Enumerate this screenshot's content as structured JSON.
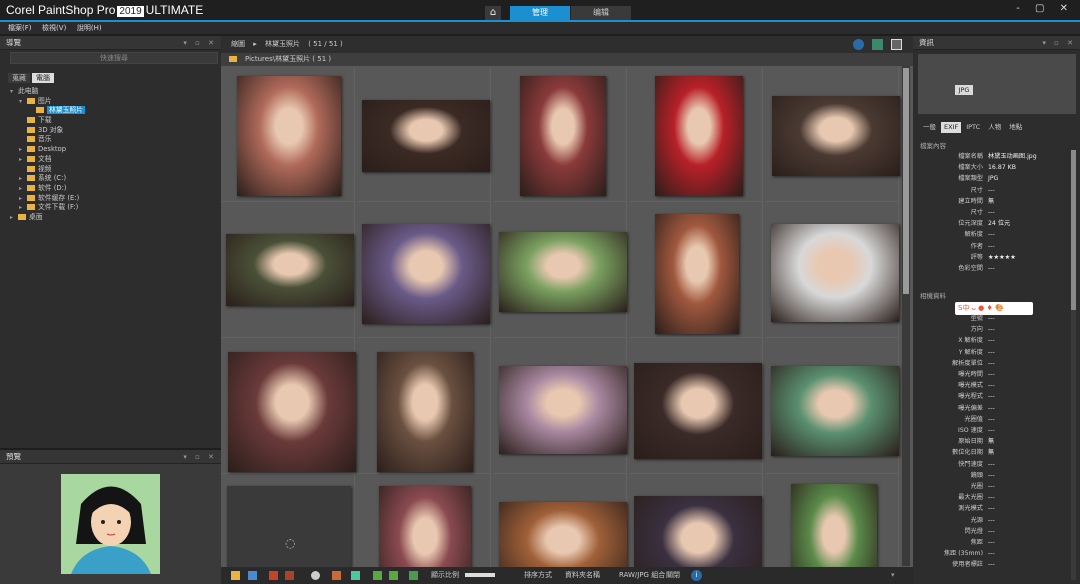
{
  "app": {
    "brand": "Corel PaintShop Pro",
    "year": "2019",
    "edition": "ULTIMATE",
    "tabs": [
      "管理",
      "编辑"
    ],
    "window_controls": "- ▢ ✕"
  },
  "menu": [
    "檔案(F)",
    "檢視(V)",
    "說明(H)"
  ],
  "nav": {
    "title": "導覽",
    "search_placeholder": "快速搜尋",
    "tabs": [
      "蒐藏",
      "電腦"
    ],
    "tree": [
      {
        "label": "此电脑",
        "depth": 0,
        "arrow": "▾",
        "folder": false
      },
      {
        "label": "图片",
        "depth": 1,
        "arrow": "▾",
        "folder": true
      },
      {
        "label": "林黛玉照片",
        "depth": 2,
        "arrow": "",
        "folder": true,
        "selected": true
      },
      {
        "label": "下载",
        "depth": 1,
        "arrow": "",
        "folder": true
      },
      {
        "label": "3D 对象",
        "depth": 1,
        "arrow": "",
        "folder": true
      },
      {
        "label": "音乐",
        "depth": 1,
        "arrow": "",
        "folder": true
      },
      {
        "label": "Desktop",
        "depth": 1,
        "arrow": "▸",
        "folder": true
      },
      {
        "label": "文档",
        "depth": 1,
        "arrow": "▸",
        "folder": true
      },
      {
        "label": "视频",
        "depth": 1,
        "arrow": "",
        "folder": true
      },
      {
        "label": "系统 (C:)",
        "depth": 1,
        "arrow": "▸",
        "folder": true
      },
      {
        "label": "软件 (D:)",
        "depth": 1,
        "arrow": "▸",
        "folder": true
      },
      {
        "label": "软件缓存 (E:)",
        "depth": 1,
        "arrow": "▸",
        "folder": true
      },
      {
        "label": "文件下载 (F:)",
        "depth": 1,
        "arrow": "▸",
        "folder": true
      },
      {
        "label": "桌面",
        "depth": 0,
        "arrow": "▸",
        "folder": true
      }
    ]
  },
  "preview": {
    "title": "預覽"
  },
  "main": {
    "crumb": "縮圖",
    "crumb_sep": "▸",
    "folder": "林黛玉照片",
    "count": "( 51 / 51 )",
    "path": "Pictures\\林黛玉照片 ( 51 )"
  },
  "thumb_colors": [
    "#b06a5a",
    "#3b2a24",
    "#8a3a3a",
    "#b82028",
    "#4a3a32",
    "#4a5038",
    "#6a5a88",
    "#7aa060",
    "#a0583e",
    "#d8d8d8",
    "#6a3a3a",
    "#6a5040",
    "#a888a0",
    "#3a2a28",
    "#5a9070",
    "#3a3a3a",
    "#8a4a50",
    "#a06038",
    "#3a3040",
    "#5a8a4a"
  ],
  "toolbar": {
    "zoom_label": "顯示比例",
    "sort_label": "排序方式",
    "sort_value": "資料夾名稱",
    "raw_label": "RAW/JPG 組合",
    "raw_value": "關閉"
  },
  "info": {
    "title": "資訊",
    "badge": "JPG",
    "tabs": [
      "一般",
      "EXIF",
      "IPTC",
      "人物",
      "地點"
    ],
    "section1": "檔案內容",
    "file_props": [
      {
        "k": "檔案名稱",
        "v": "林黛玉动画图.jpg"
      },
      {
        "k": "檔案大小",
        "v": "16.87 KB"
      },
      {
        "k": "檔案類型",
        "v": "JPG"
      },
      {
        "k": "尺寸",
        "v": "---"
      },
      {
        "k": "建立時間",
        "v": "無"
      },
      {
        "k": "尺寸",
        "v": "---"
      },
      {
        "k": "位元深度",
        "v": "24 位元"
      },
      {
        "k": "解析度",
        "v": "---"
      },
      {
        "k": "作者",
        "v": "---"
      },
      {
        "k": "評等",
        "v": "★★★★★"
      },
      {
        "k": "色彩空間",
        "v": "---"
      }
    ],
    "section2": "相機資料",
    "logo_text": "S中 ᴗ ● ♦ 🎨",
    "camera_props": [
      {
        "k": "型號",
        "v": "---"
      },
      {
        "k": "方向",
        "v": "---"
      },
      {
        "k": "X 解析度",
        "v": "---"
      },
      {
        "k": "Y 解析度",
        "v": "---"
      },
      {
        "k": "解析度單位",
        "v": "---"
      },
      {
        "k": "曝光時間",
        "v": "---"
      },
      {
        "k": "曝光模式",
        "v": "---"
      },
      {
        "k": "曝光程式",
        "v": "---"
      },
      {
        "k": "曝光偏差",
        "v": "---"
      },
      {
        "k": "光圈值",
        "v": "---"
      },
      {
        "k": "ISO 速度",
        "v": "---"
      },
      {
        "k": "原始日期",
        "v": "無"
      },
      {
        "k": "數位化日期",
        "v": "無"
      },
      {
        "k": "快門速度",
        "v": "---"
      },
      {
        "k": "鏡頭",
        "v": "---"
      },
      {
        "k": "光圈",
        "v": "---"
      },
      {
        "k": "最大光圈",
        "v": "---"
      },
      {
        "k": "測光模式",
        "v": "---"
      },
      {
        "k": "光源",
        "v": "---"
      },
      {
        "k": "閃光燈",
        "v": "---"
      },
      {
        "k": "焦距",
        "v": "---"
      },
      {
        "k": "焦距 (35mm)",
        "v": "---"
      },
      {
        "k": "使用者標註",
        "v": "---"
      }
    ]
  }
}
